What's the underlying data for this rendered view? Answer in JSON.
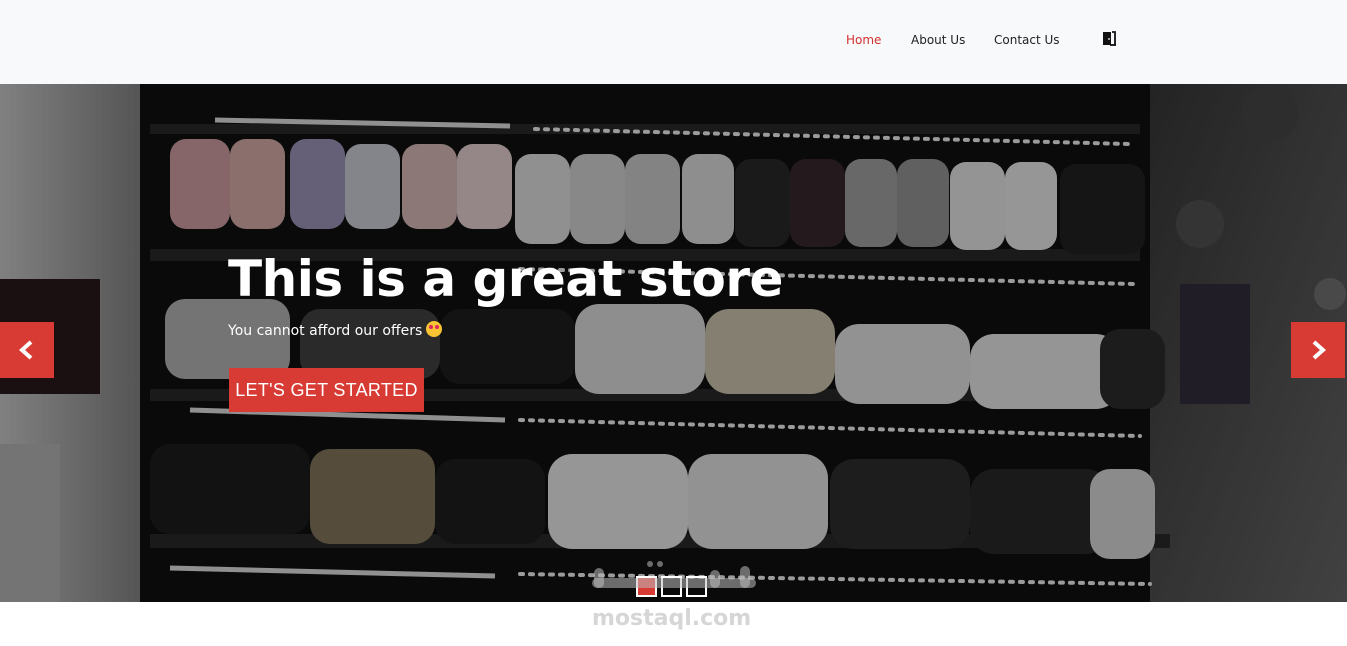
{
  "nav": {
    "home": "Home",
    "about": "About Us",
    "contact": "Contact Us",
    "login_icon": "login-door-icon"
  },
  "hero": {
    "title": "This is a great store",
    "subtitle": "You cannot afford our offers",
    "subtitle_emoji": "star-struck-emoji",
    "cta": "LET'S GET STARTED",
    "slides_count": 3,
    "active_slide": 1
  },
  "controls": {
    "prev_icon": "chevron-left-icon",
    "next_icon": "chevron-right-icon"
  },
  "watermark": {
    "text": "mostaql.com"
  },
  "colors": {
    "accent": "#d83a34",
    "nav_active": "#d32f2f",
    "navbar_bg": "#f8f9fa"
  }
}
